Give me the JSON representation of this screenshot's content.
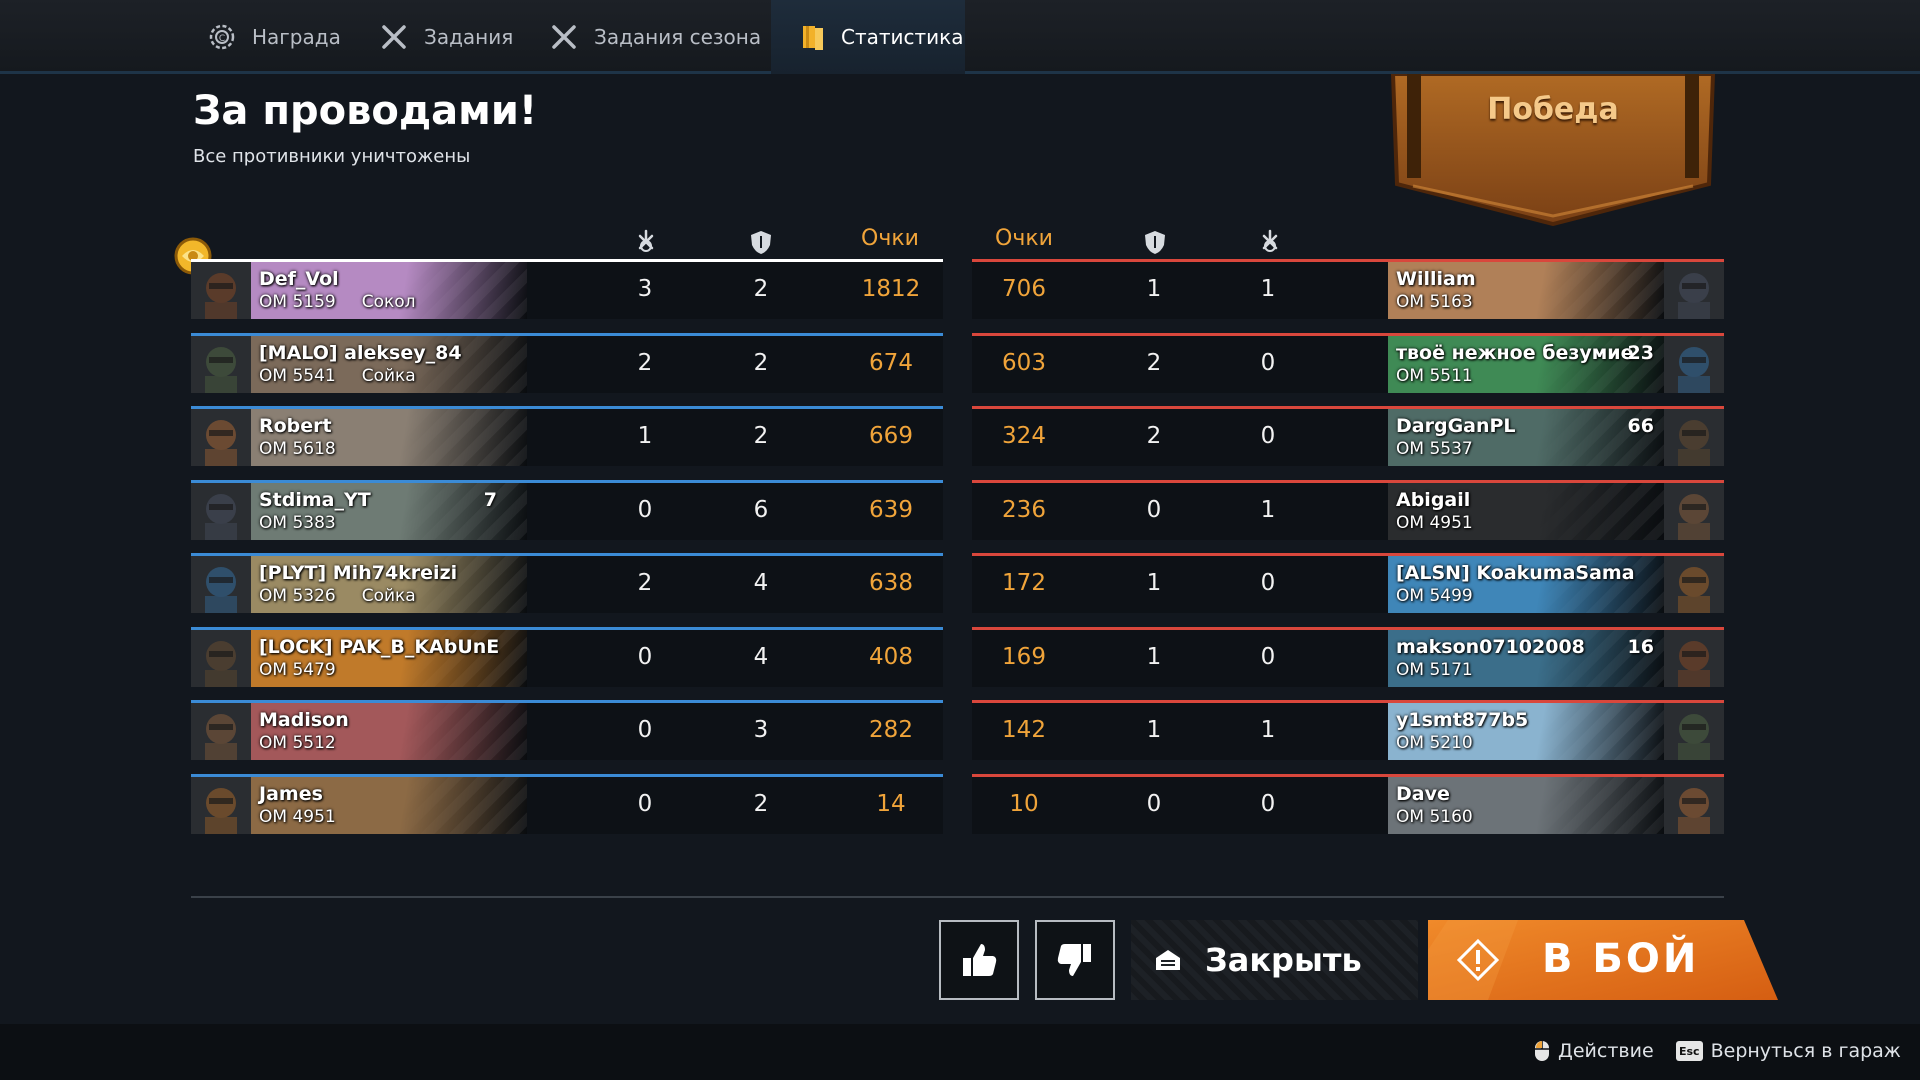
{
  "tabs": [
    {
      "label": "Награда",
      "icon": "gear-medal-icon"
    },
    {
      "label": "Задания",
      "icon": "crossed-swords-icon"
    },
    {
      "label": "Задания сезона",
      "icon": "crossed-swords-icon"
    },
    {
      "label": "Статистика",
      "icon": "book-icon",
      "active": true
    }
  ],
  "header": {
    "title": "За проводами!",
    "subtitle": "Все противники уничтожены",
    "result": "Победа"
  },
  "columns": {
    "kills_icon": "crosshair-kills-icon",
    "assists_icon": "shield-icon",
    "points_label": "Очки"
  },
  "team_left": [
    {
      "name": "Def_Vol",
      "om": "ОМ 5159",
      "badge": "Сокол",
      "kills": "3",
      "assists": "2",
      "points": "1812",
      "card": "#b58ac2",
      "mvp": true
    },
    {
      "name": "[MALO] aleksey_84",
      "om": "ОМ 5541",
      "badge": "Сойка",
      "kills": "2",
      "assists": "2",
      "points": "674",
      "card": "#7b6a5a"
    },
    {
      "name": "Robert",
      "om": "ОМ 5618",
      "badge": "",
      "kills": "1",
      "assists": "2",
      "points": "669",
      "card": "#8a7f73"
    },
    {
      "name": "Stdima_YT",
      "om": "ОМ 5383",
      "badge": "",
      "level": "7",
      "kills": "0",
      "assists": "6",
      "points": "639",
      "card": "#6e7b74"
    },
    {
      "name": "[PLYT] Mih74kreizi",
      "om": "ОМ 5326",
      "badge": "Сойка",
      "kills": "2",
      "assists": "4",
      "points": "638",
      "card": "#9a8a63"
    },
    {
      "name": "[LOCK] PAK_B_KAbUnE",
      "om": "ОМ 5479",
      "badge": "",
      "kills": "0",
      "assists": "4",
      "points": "408",
      "card": "#c07a2a"
    },
    {
      "name": "Madison",
      "om": "ОМ 5512",
      "badge": "",
      "kills": "0",
      "assists": "3",
      "points": "282",
      "card": "#a3585a"
    },
    {
      "name": "James",
      "om": "ОМ 4951",
      "badge": "",
      "kills": "0",
      "assists": "2",
      "points": "14",
      "card": "#8c6a45"
    }
  ],
  "team_right": [
    {
      "name": "William",
      "om": "ОМ 5163",
      "level": "",
      "points": "706",
      "assists": "1",
      "kills": "1",
      "card": "#b08058"
    },
    {
      "name": "твоё нежное безумие",
      "om": "ОМ 5511",
      "level": "23",
      "points": "603",
      "assists": "2",
      "kills": "0",
      "card": "#3f8a55"
    },
    {
      "name": "DargGanPL",
      "om": "ОМ 5537",
      "level": "66",
      "points": "324",
      "assists": "2",
      "kills": "0",
      "card": "#4f6b66"
    },
    {
      "name": "Abigail",
      "om": "ОМ 4951",
      "level": "",
      "points": "236",
      "assists": "0",
      "kills": "1",
      "card": "#2a2c2e"
    },
    {
      "name": "[ALSN] KoakumaSama",
      "om": "ОМ 5499",
      "level": "",
      "points": "172",
      "assists": "1",
      "kills": "0",
      "card": "#3f86b8"
    },
    {
      "name": "makson07102008",
      "om": "ОМ 5171",
      "level": "16",
      "points": "169",
      "assists": "1",
      "kills": "0",
      "card": "#3b6e8a"
    },
    {
      "name": "y1smt877b5",
      "om": "ОМ 5210",
      "level": "",
      "points": "142",
      "assists": "1",
      "kills": "1",
      "card": "#8ab3cf"
    },
    {
      "name": "Dave",
      "om": "ОМ 5160",
      "level": "",
      "points": "10",
      "assists": "0",
      "kills": "0",
      "card": "#6c7378"
    }
  ],
  "buttons": {
    "like_icon": "thumbs-up-icon",
    "dislike_icon": "thumbs-down-icon",
    "close_label": "Закрыть",
    "fight_label": "В БОЙ"
  },
  "footer": {
    "action_label": "Действие",
    "esc_key": "Esc",
    "garage_label": "Вернуться в гараж"
  },
  "colors": {
    "accent": "#f0a43a",
    "team_left": "#3b8bd6",
    "team_right": "#d9473c",
    "fight_button": "#e8741e"
  }
}
